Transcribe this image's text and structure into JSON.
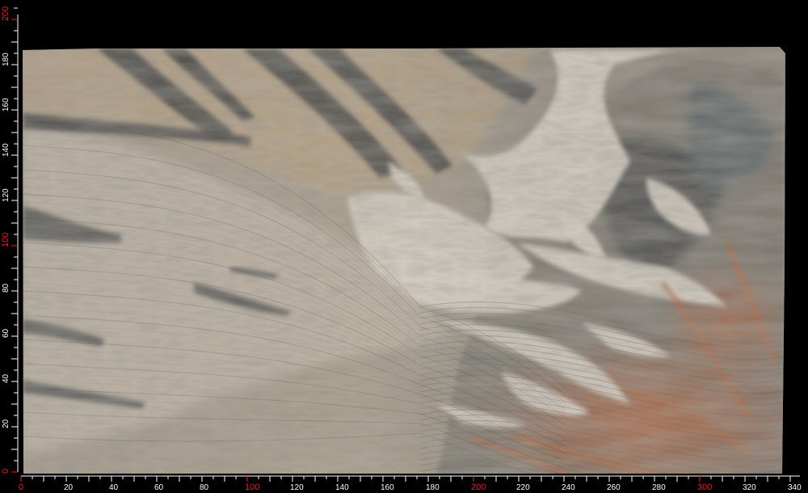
{
  "slab": {
    "colors": {
      "base": "#a89a86",
      "cream": "#d2c7b7",
      "grey": "#77736b",
      "dark": "#2e3336",
      "blue": "#4b5a61",
      "rust": "#b3643a",
      "tan": "#c2a57c"
    }
  },
  "ruler": {
    "color_minor": "#ffffff",
    "color_major": "#e02020",
    "x_labels": [
      "0",
      "20",
      "40",
      "60",
      "80",
      "100",
      "120",
      "140",
      "160",
      "180",
      "200",
      "220",
      "240",
      "260",
      "280",
      "300",
      "320",
      "340"
    ],
    "y_labels": [
      "0",
      "20",
      "40",
      "60",
      "80",
      "100",
      "120",
      "140",
      "160",
      "180",
      "200"
    ]
  }
}
